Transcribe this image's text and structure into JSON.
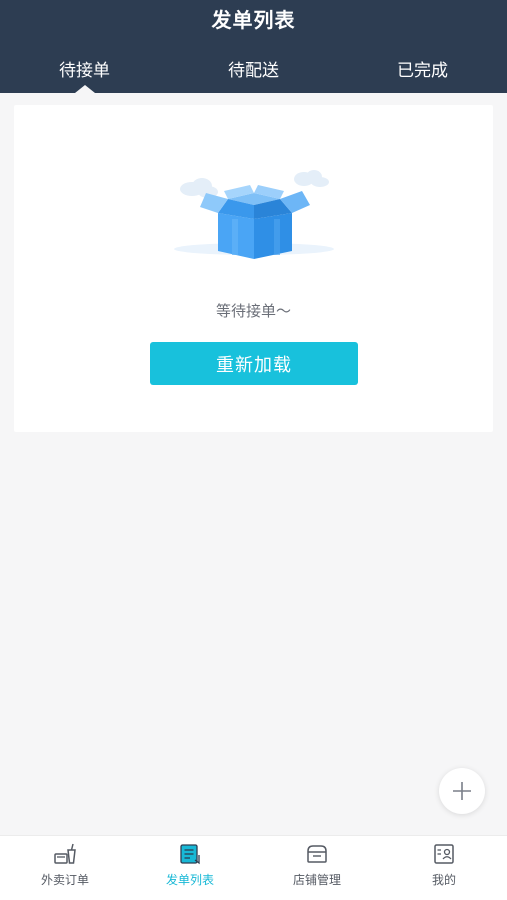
{
  "header": {
    "title": "发单列表",
    "tabs": [
      {
        "label": "待接单",
        "active": true
      },
      {
        "label": "待配送",
        "active": false
      },
      {
        "label": "已完成",
        "active": false
      }
    ]
  },
  "main": {
    "empty_text": "等待接单～",
    "reload_label": "重新加载"
  },
  "fab": {
    "icon": "plus-icon"
  },
  "bottom_nav": {
    "items": [
      {
        "label": "外卖订单",
        "icon": "takeout-order-icon",
        "active": false
      },
      {
        "label": "发单列表",
        "icon": "order-list-icon",
        "active": true
      },
      {
        "label": "店铺管理",
        "icon": "store-icon",
        "active": false
      },
      {
        "label": "我的",
        "icon": "profile-card-icon",
        "active": false
      }
    ]
  },
  "colors": {
    "header_bg": "#2d3d52",
    "accent": "#18c1dc",
    "page_bg": "#f6f6f7"
  }
}
